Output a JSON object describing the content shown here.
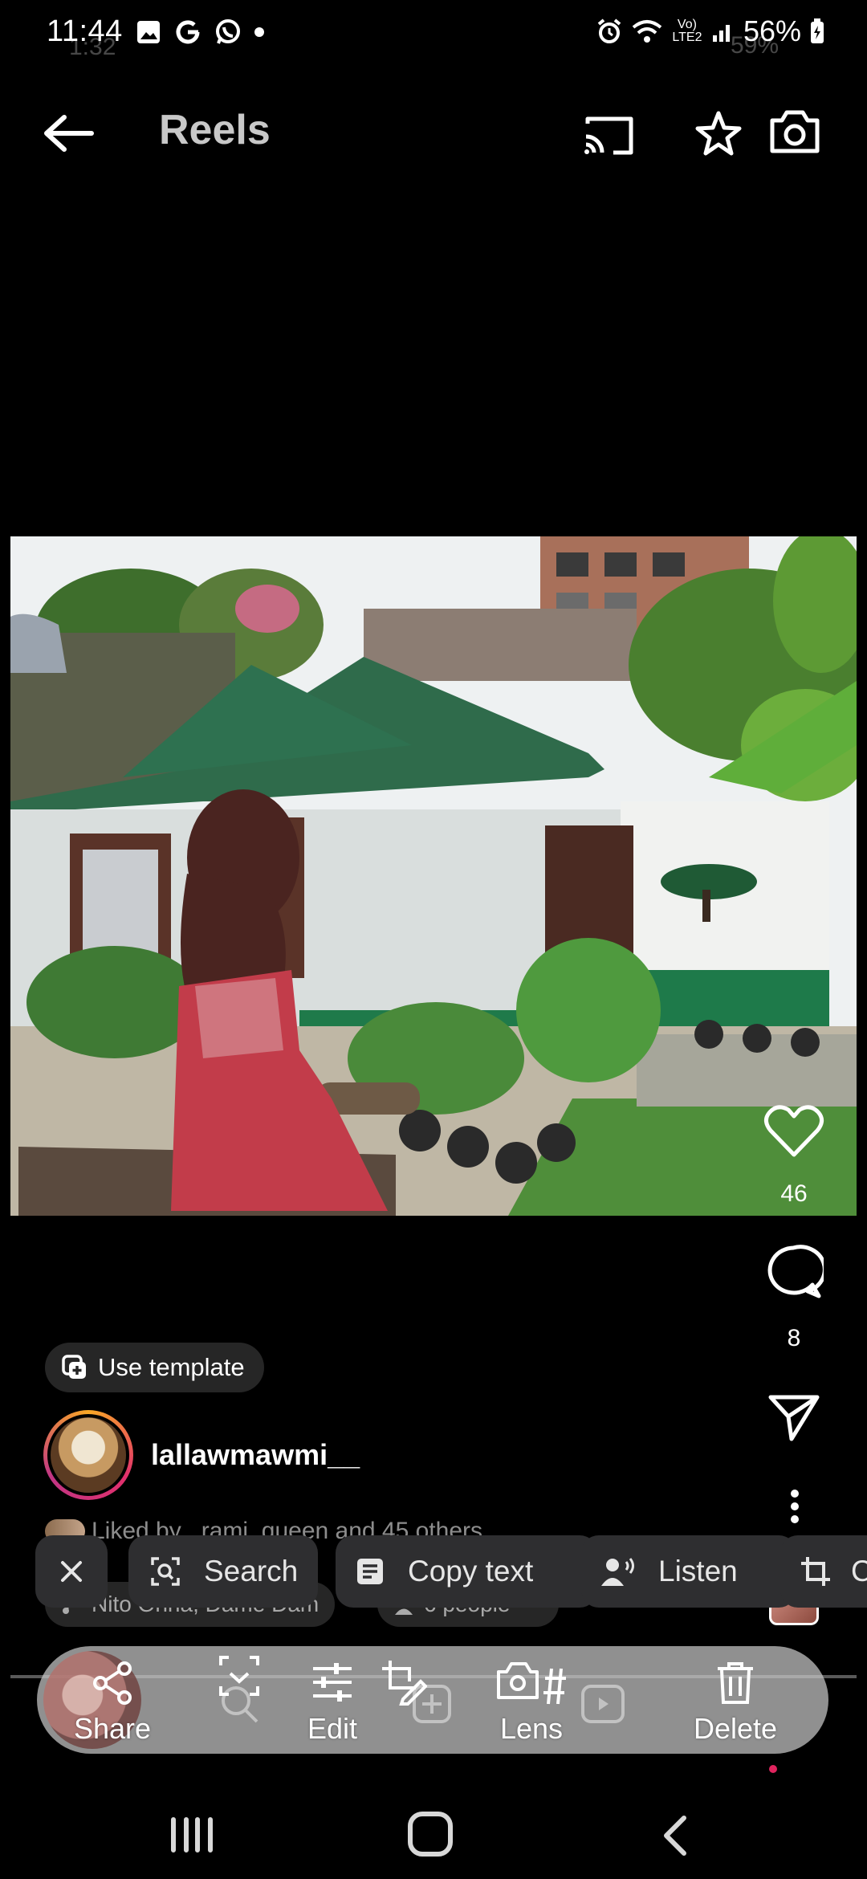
{
  "status_bar": {
    "time": "11:44",
    "ghost_time": "1:32",
    "battery": "56%",
    "ghost_battery": "59%",
    "network": "Vo) LTE2"
  },
  "header": {
    "title": "Reels"
  },
  "post": {
    "likes": "46",
    "comments": "8",
    "use_template_label": "Use template",
    "username": "lallawmawmi__",
    "liked_by": "Liked by _rami_queen and 45 others",
    "audio": "Nito Ohna, Dame Dam",
    "people": "6 people"
  },
  "selection_chips": {
    "search": "Search",
    "copy_text": "Copy text",
    "listen": "Listen",
    "crop": "C"
  },
  "toolbar": {
    "share": "Share",
    "edit": "Edit",
    "lens": "Lens",
    "delete": "Delete"
  },
  "colors": {
    "background": "#000000",
    "chip_bg": "#2e2e30",
    "toolbar_bg": "#c8c8c8",
    "accent_like": "#ffffff",
    "story_ring": "#e1306c"
  }
}
